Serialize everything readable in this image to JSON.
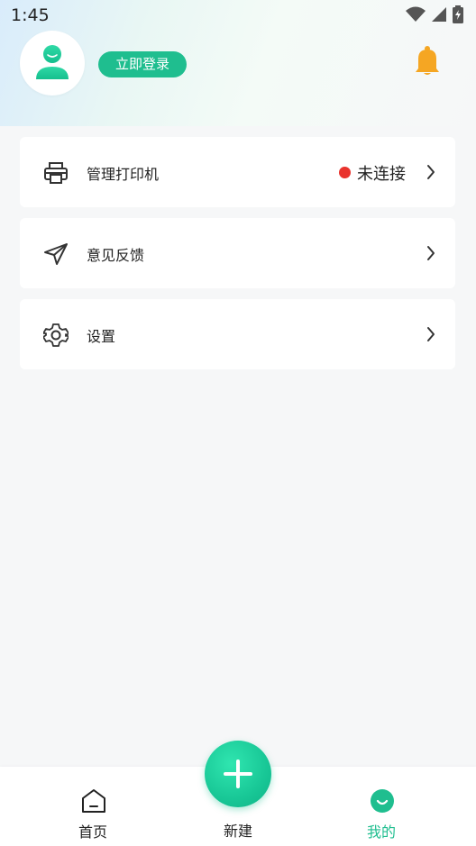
{
  "status_bar": {
    "time": "1:45"
  },
  "profile": {
    "login_label": "立即登录"
  },
  "menu": {
    "items": [
      {
        "label": "管理打印机",
        "status": "未连接"
      },
      {
        "label": "意见反馈"
      },
      {
        "label": "设置"
      }
    ]
  },
  "tabbar": {
    "home_label": "首页",
    "new_label": "新建",
    "mine_label": "我的"
  },
  "colors": {
    "accent": "#1fbe8f",
    "status_disconnected": "#e9332d",
    "bell": "#f5a623"
  }
}
